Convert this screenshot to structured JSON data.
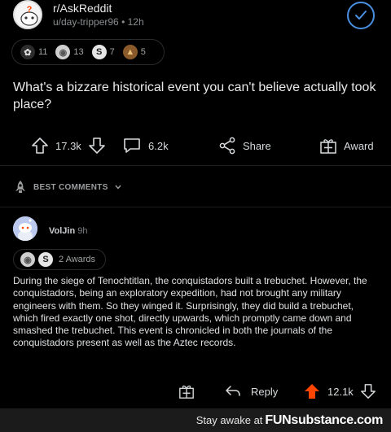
{
  "post": {
    "subreddit": "r/AskReddit",
    "user": "u/day-tripper96",
    "age": "12h",
    "awards": [
      {
        "icon": "wholesome-award-icon",
        "count": "11"
      },
      {
        "icon": "silver-award-icon",
        "count": "13"
      },
      {
        "icon": "take-my-power-award-icon",
        "count": "7"
      },
      {
        "icon": "poop-award-icon",
        "count": "5"
      }
    ],
    "title": "What's a bizzare historical event you can't believe actually took place?",
    "upvotes": "17.3k",
    "comments": "6.2k",
    "share_label": "Share",
    "award_label": "Award"
  },
  "sort": {
    "label": "BEST COMMENTS"
  },
  "comment": {
    "author": "VolJin",
    "age": "9h",
    "awards_label": "2 Awards",
    "body": "During the siege of Tenochtitlan, the conquistadors built a trebuchet. However, the conquistadors, being an exploratory expedition, had not brought any military engineers with them. So they winged it. Surprisingly, they did build a trebuchet, which fired exactly one shot, directly upwards, which promptly came down and smashed the trebuchet. This event is chronicled in both the journals of the conquistadors present as well as the Aztec records.",
    "reply_label": "Reply",
    "score": "12.1k"
  },
  "footer": {
    "text": "Stay awake at",
    "brand": "FUNsubstance.com"
  },
  "colors": {
    "accent_blue": "#4a90e2",
    "upvote_orange": "#ff4500",
    "background": "#000000"
  }
}
